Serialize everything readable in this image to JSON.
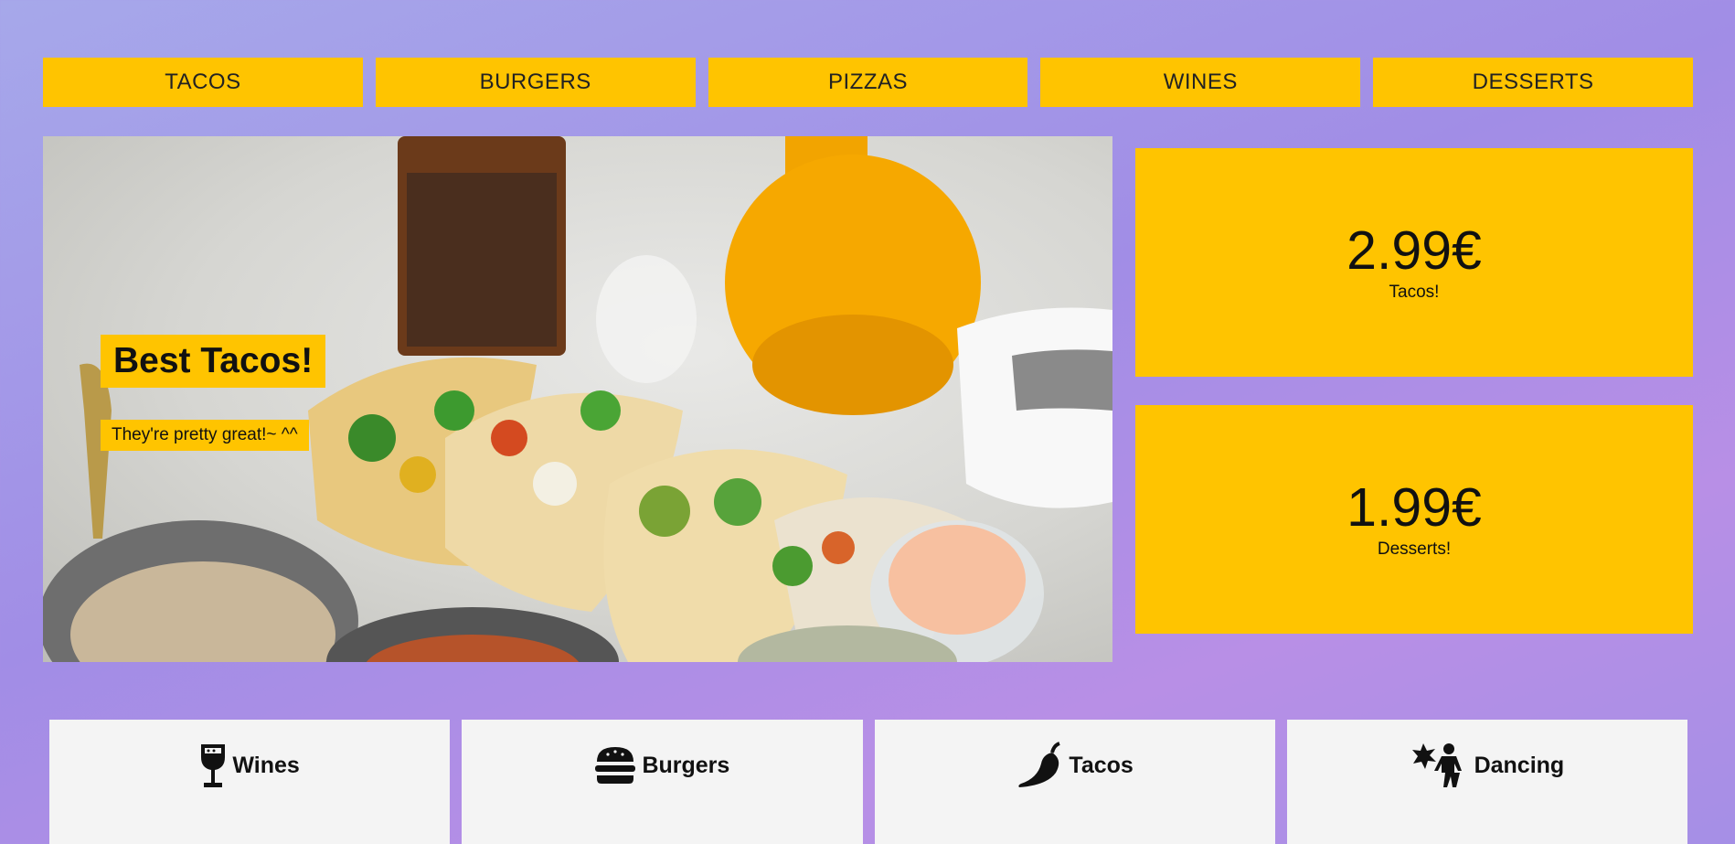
{
  "nav": {
    "items": [
      {
        "label": "TACOS"
      },
      {
        "label": "BURGERS"
      },
      {
        "label": "PIZZAS"
      },
      {
        "label": "WINES"
      },
      {
        "label": "DESSERTS"
      }
    ]
  },
  "hero": {
    "title": "Best Tacos!",
    "subtitle": "They're pretty great!~ ^^"
  },
  "promos": [
    {
      "price": "2.99€",
      "label": "Tacos!"
    },
    {
      "price": "1.99€",
      "label": "Desserts!"
    }
  ],
  "categories": [
    {
      "label": "Wines",
      "icon": "wine-glass-icon"
    },
    {
      "label": "Burgers",
      "icon": "burger-icon"
    },
    {
      "label": "Tacos",
      "icon": "pepper-icon"
    },
    {
      "label": "Dancing",
      "icon": "dancing-icon"
    }
  ],
  "colors": {
    "accent": "#ffc400",
    "card": "#f4f4f4",
    "background": "#a18de6"
  }
}
